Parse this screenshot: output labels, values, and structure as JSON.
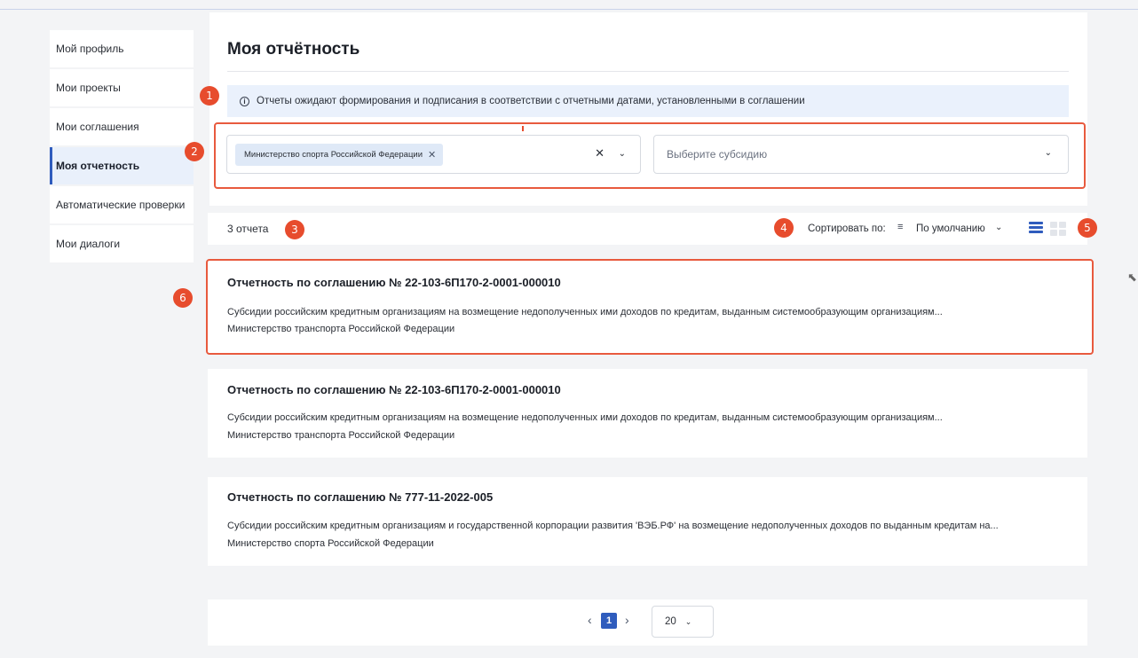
{
  "sidebar": {
    "items": [
      {
        "label": "Мой профиль"
      },
      {
        "label": "Мои проекты"
      },
      {
        "label": "Мои соглашения"
      },
      {
        "label": "Моя отчетность"
      },
      {
        "label": "Автоматические проверки"
      },
      {
        "label": "Мои диалоги"
      }
    ],
    "active_index": 3
  },
  "header": {
    "title": "Моя отчётность",
    "info_text": "Отчеты ожидают формирования и подписания в соответствии с отчетными датами, установленными в соглашении",
    "info_icon": "i"
  },
  "filters": {
    "ministry_chip": "Министерство спорта Российской Федерации",
    "chip_remove": "✕",
    "clear": "✕",
    "subsidy_placeholder": "Выберите субсидию"
  },
  "list": {
    "count": "3 отчета",
    "sort_label": "Сортировать по:",
    "sort_value": "По умолчанию",
    "sort_icon": "≡",
    "cards": [
      {
        "title": "Отчетность по соглашению № 22-103-6П170-2-0001-000010",
        "description": "Субсидии российским кредитным организациям на возмещение недополученных ими доходов по кредитам, выданным системообразующим организациям...",
        "org": "Министерство транспорта Российской Федерации"
      },
      {
        "title": "Отчетность по соглашению № 22-103-6П170-2-0001-000010",
        "description": "Субсидии российским кредитным организациям на возмещение недополученных ими доходов по кредитам, выданным системообразующим организациям...",
        "org": "Министерство транспорта Российской Федерации"
      },
      {
        "title": "Отчетность по соглашению № 777-11-2022-005",
        "description": "Субсидии российским кредитным организациям и государственной корпорации развития 'ВЭБ.РФ' на возмещение недополученных доходов по выданным кредитам на...",
        "org": "Министерство спорта Российской Федерации"
      }
    ]
  },
  "pagination": {
    "prev": "‹",
    "current_page": "1",
    "next": "›",
    "page_size": "20"
  },
  "annotations": [
    "1",
    "2",
    "3",
    "4",
    "5",
    "6"
  ],
  "colors": {
    "accent": "#2f5cbd",
    "annotation": "#e74c2d",
    "info_bg": "#eaf1fc"
  }
}
